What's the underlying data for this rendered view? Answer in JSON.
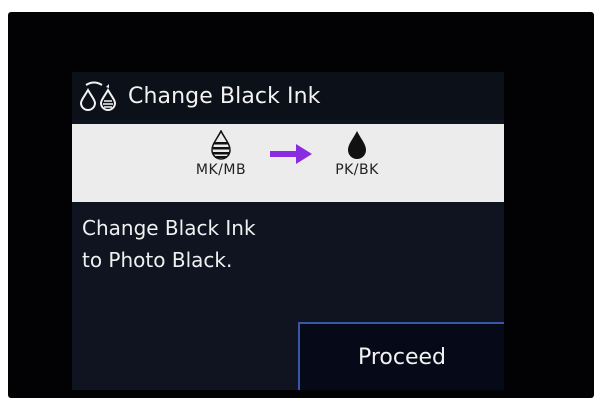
{
  "screen": {
    "title": "Change Black Ink",
    "title_icon": "ink-exchange-icon"
  },
  "ink_change": {
    "from_label": "MK/MB",
    "from_icon": "striped-ink-drop-icon",
    "to_label": "PK/BK",
    "to_icon": "solid-ink-drop-icon",
    "arrow_icon": "arrow-right-icon",
    "arrow_color": "#8a2be2"
  },
  "message": {
    "line1": "Change Black Ink",
    "line2": "to Photo Black."
  },
  "actions": {
    "proceed_label": "Proceed"
  },
  "colors": {
    "screen_bg": "#0f1420",
    "panel_bg": "#ececec",
    "button_border": "#3b55a8"
  }
}
